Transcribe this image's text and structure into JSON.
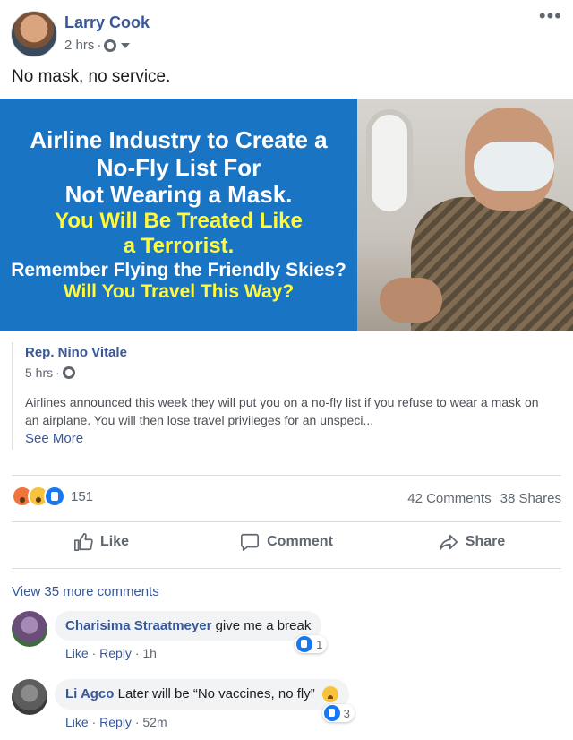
{
  "post": {
    "author": "Larry Cook",
    "time": "2 hrs",
    "dot": "·",
    "text": "No mask, no service."
  },
  "banner": {
    "line1": "Airline Industry to Create a",
    "line2": "No-Fly List For",
    "line3": "Not Wearing a Mask.",
    "line4": "You Will Be Treated Like",
    "line5": "a Terrorist.",
    "line6": "Remember Flying the Friendly Skies?",
    "line7": "Will You Travel This Way?"
  },
  "shared": {
    "author": "Rep. Nino Vitale",
    "time": "5 hrs",
    "dot": "·",
    "body": "Airlines announced this week they will put you on a no-fly list if you refuse to wear a mask on an airplane. You will then lose travel privileges for an unspeci...",
    "see_more": "See More"
  },
  "stats": {
    "reaction_count": "151",
    "comments": "42 Comments",
    "shares": "38 Shares",
    "reaction_icons": [
      "angry-icon",
      "wow-icon",
      "like-icon"
    ]
  },
  "actions": {
    "like": "Like",
    "comment": "Comment",
    "share": "Share"
  },
  "view_more_comments": "View 35 more comments",
  "comments": [
    {
      "name": "Charisima Straatmeyer",
      "text": "give me a break",
      "like": "Like",
      "reply": "Reply",
      "time": "1h",
      "reactions": "1"
    },
    {
      "name": "Li Agco",
      "text": "Later will be “No vaccines, no fly”",
      "like": "Like",
      "reply": "Reply",
      "time": "52m",
      "reactions": "3"
    }
  ],
  "colors": {
    "link_blue": "#385898",
    "banner_blue": "#1a74c4",
    "banner_yellow": "#fffa3f"
  }
}
